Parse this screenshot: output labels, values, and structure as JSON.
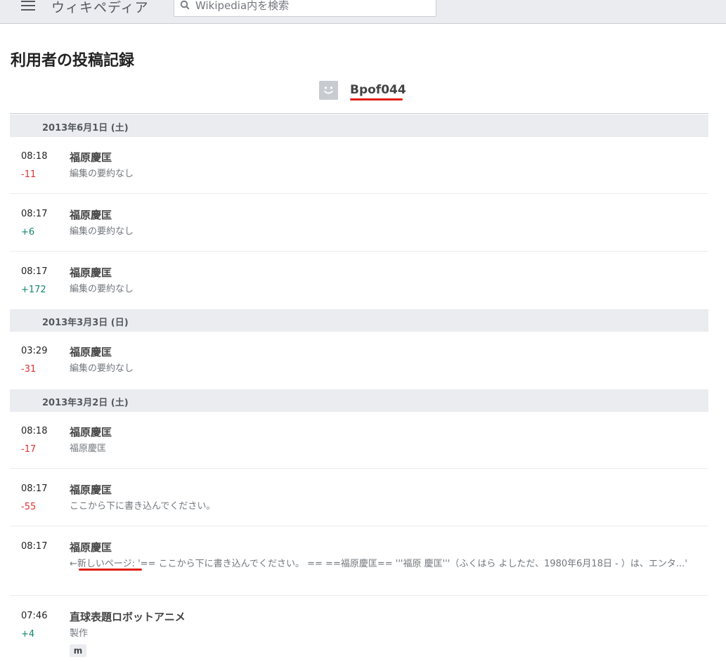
{
  "header": {
    "brand": "ウィキペディア",
    "search_placeholder": "Wikipedia内を検索"
  },
  "page": {
    "title": "利用者の投稿記録",
    "username": "Bpof044"
  },
  "days": [
    {
      "date": "2013年6月1日 (土)"
    },
    {
      "date": "2013年3月3日 (日)"
    },
    {
      "date": "2013年3月2日 (土)"
    }
  ],
  "entries": [
    {
      "time": "08:18",
      "diff": "-11",
      "title": "福原慶匡",
      "summary": "編集の要約なし"
    },
    {
      "time": "08:17",
      "diff": "+6",
      "title": "福原慶匡",
      "summary": "編集の要約なし"
    },
    {
      "time": "08:17",
      "diff": "+172",
      "title": "福原慶匡",
      "summary": "編集の要約なし"
    },
    {
      "time": "03:29",
      "diff": "-31",
      "title": "福原慶匡",
      "summary": "編集の要約なし"
    },
    {
      "time": "08:18",
      "diff": "-17",
      "title": "福原慶匡",
      "summary": "福原慶匡"
    },
    {
      "time": "08:17",
      "diff": "-55",
      "title": "福原慶匡",
      "summary": "ここから下に書き込んでください。"
    },
    {
      "time": "08:17",
      "diff": "",
      "title": "福原慶匡",
      "summary_link": "←新しいページ",
      "summary": ": '== ここから下に書き込んでください。 == ==福原慶匡== '''福原 慶匡'''（ふくはら よしただ、1980年6月18日 - ）は、エンタ...'"
    },
    {
      "time": "07:46",
      "diff": "+4",
      "title": "直球表題ロボットアニメ",
      "summary": "製作",
      "tag": "m"
    }
  ],
  "colors": {
    "negative": "#d33333",
    "positive": "#14866d",
    "highlight": "#e01e10"
  }
}
